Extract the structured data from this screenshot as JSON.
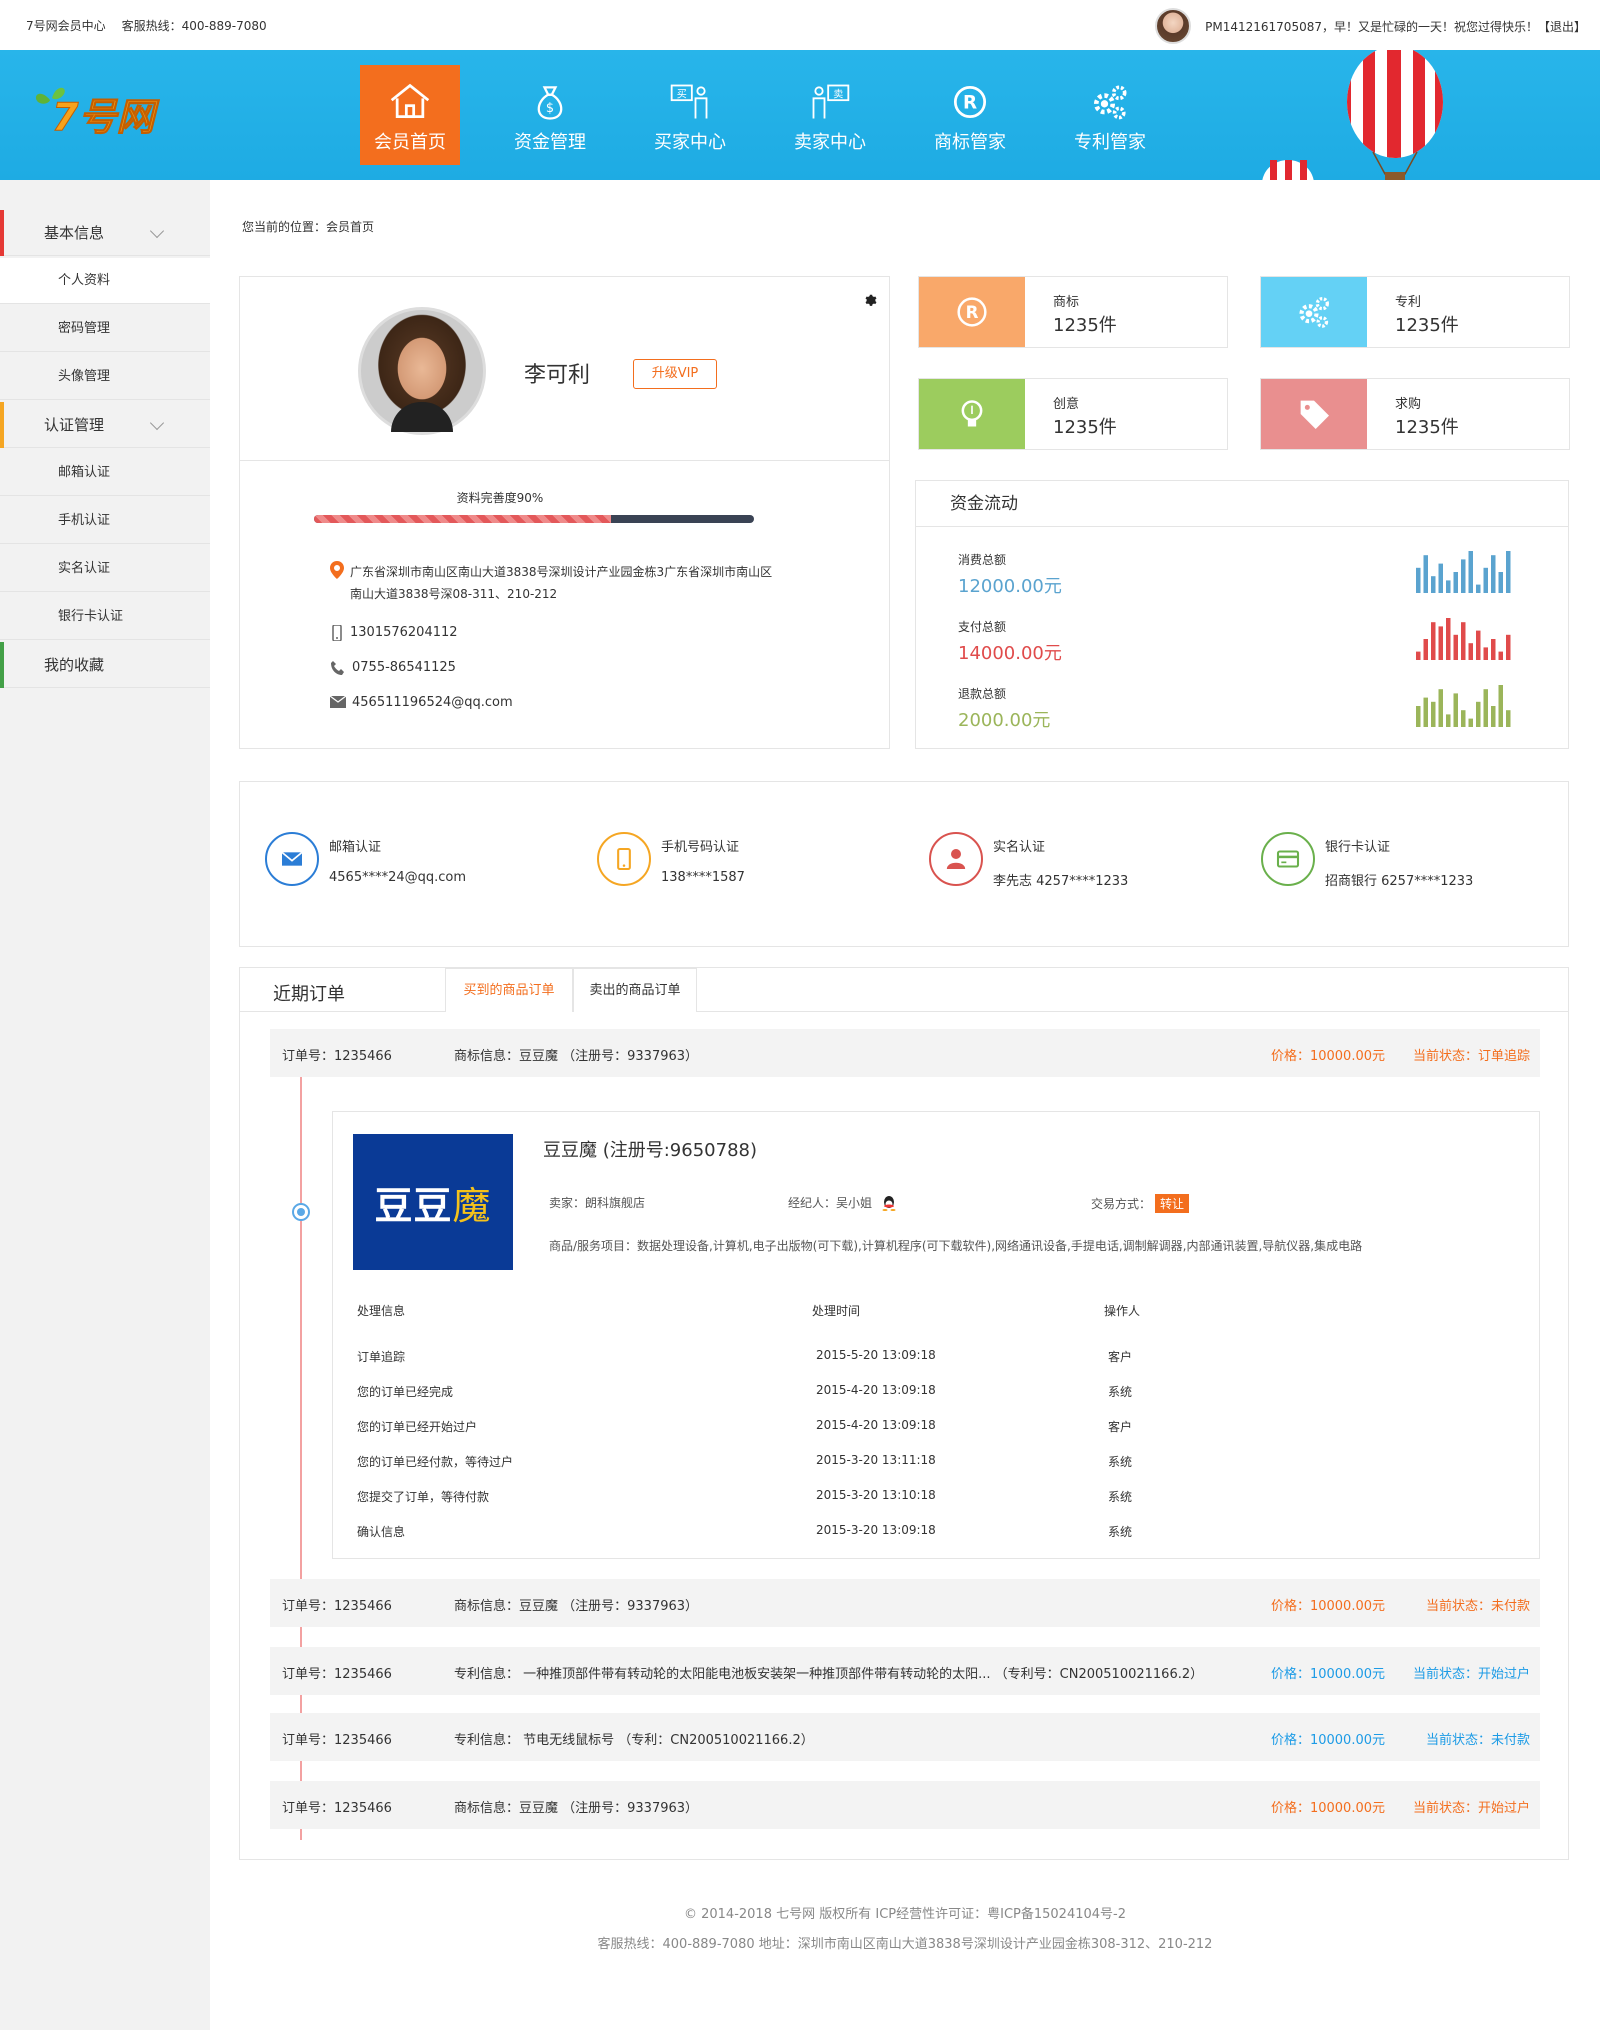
{
  "topbar": {
    "site": "7号网会员中心",
    "hotline": "客服热线：400-889-7080",
    "greeting": "PM1412161705087，早！又是忙碌的一天！祝您过得快乐！",
    "logout": "【退出】"
  },
  "header": {
    "logo_text": "7号网",
    "nav": [
      {
        "label": "会员首页",
        "icon": "home-icon",
        "active": true
      },
      {
        "label": "资金管理",
        "icon": "money-bag-icon"
      },
      {
        "label": "买家中心",
        "icon": "buyer-icon"
      },
      {
        "label": "卖家中心",
        "icon": "seller-icon"
      },
      {
        "label": "商标管家",
        "icon": "registered-icon"
      },
      {
        "label": "专利管家",
        "icon": "gears-icon"
      }
    ]
  },
  "sidebar": {
    "groups": [
      {
        "label": "基本信息",
        "color": "#e53935",
        "items": [
          "个人资料",
          "密码管理",
          "头像管理"
        ]
      },
      {
        "label": "认证管理",
        "color": "#f5a623",
        "items": [
          "邮箱认证",
          "手机认证",
          "实名认证",
          "银行卡认证"
        ]
      },
      {
        "label": "我的收藏",
        "color": "#43a047",
        "items": []
      }
    ]
  },
  "breadcrumb": "您当前的位置：会员首页",
  "profile": {
    "name": "李可利",
    "vip_button": "升级VIP",
    "completeness": "资料完善度90%",
    "completeness_value": 0.9,
    "address_line1": "广东省深圳市南山区南山大道3838号深圳设计产业园金栋3广东省深圳市南山区",
    "address_line2": "南山大道3838号深08-311、210-212",
    "mobile": "13015762041​12",
    "phone": "0755-86541125",
    "email": "456511196524@qq.com"
  },
  "stats": [
    {
      "label": "商标",
      "value": "1235件",
      "color": "#f9a86a",
      "icon": "registered-icon"
    },
    {
      "label": "专利",
      "value": "1235件",
      "color": "#64d1f5",
      "icon": "gears-icon"
    },
    {
      "label": "创意",
      "value": "1235件",
      "color": "#9ccc5e",
      "icon": "bulb-icon"
    },
    {
      "label": "求购",
      "value": "1235件",
      "color": "#e98f8f",
      "icon": "tag-icon"
    }
  ],
  "fund": {
    "title": "资金流动",
    "rows": [
      {
        "label": "消费总额",
        "value": "12000.00元",
        "color": "#5aa3cf",
        "bars": [
          0.6,
          0.9,
          0.4,
          0.7,
          0.3,
          0.5,
          0.8,
          1.0,
          0.2,
          0.6,
          0.9,
          0.5,
          1.0
        ]
      },
      {
        "label": "支付总额",
        "value": "14000.00元",
        "color": "#e04b4b",
        "bars": [
          0.2,
          0.5,
          0.9,
          0.8,
          1.0,
          0.6,
          0.9,
          0.4,
          0.7,
          0.3,
          0.5,
          0.2,
          0.6
        ]
      },
      {
        "label": "退款总额",
        "value": "2000.00元",
        "color": "#9bb55a",
        "bars": [
          0.5,
          0.7,
          0.6,
          0.9,
          0.3,
          0.8,
          0.4,
          0.2,
          0.6,
          0.9,
          0.5,
          1.0,
          0.4
        ]
      }
    ]
  },
  "certs": [
    {
      "title": "邮箱认证",
      "value": "4565****24@qq.com",
      "color": "#2b7dd6",
      "icon": "mail-icon"
    },
    {
      "title": "手机号码认证",
      "value": "138****1587",
      "color": "#f5a623",
      "icon": "phone-icon"
    },
    {
      "title": "实名认证",
      "value": "李先志    4257****1233",
      "color": "#d9534f",
      "icon": "person-icon"
    },
    {
      "title": "银行卡认证",
      "value": "招商银行    6257****1233",
      "color": "#6ab04c",
      "icon": "card-icon"
    }
  ],
  "orders": {
    "title": "近期订单",
    "tabs": [
      "买到的商品订单",
      "卖出的商品订单"
    ],
    "list": [
      {
        "no": "订单号：1235466",
        "info": "商标信息：豆豆魔  （注册号：9337963）",
        "price": "价格：10000.00元",
        "status": "当前状态：订单追踪",
        "style": "orange"
      },
      {
        "no": "订单号：1235466",
        "info": "商标信息：豆豆魔  （注册号：9337963）",
        "price": "价格：10000.00元",
        "status": "当前状态：未付款",
        "style": "orange"
      },
      {
        "no": "订单号：1235466",
        "info": "专利信息：  一种推顶部件带有转动轮的太阳能电池板安装架一种推顶部件带有转动轮的太阳...  （专利号：CN200510021166.2）",
        "price": "价格：10000.00元",
        "status": "当前状态：开始过户",
        "style": "blue"
      },
      {
        "no": "订单号：1235466",
        "info": "专利信息：  节电无线鼠标号  （专利：CN200510021166.2）",
        "price": "价格：10000.00元",
        "status": "当前状态：未付款",
        "style": "blue"
      },
      {
        "no": "订单号：1235466",
        "info": "商标信息：豆豆魔  （注册号：9337963）",
        "price": "价格：10000.00元",
        "status": "当前状态：开始过户",
        "style": "orange"
      }
    ],
    "detail": {
      "logo_a": "豆豆",
      "logo_b": "魔",
      "title": "豆豆魔 (注册号:9650788)",
      "seller": "卖家：朗科旗舰店",
      "agent": "经纪人：吴小姐",
      "trade": "交易方式：",
      "trade_tag": "转让",
      "services": "商品/服务项目：数据处理设备,计算机,电子出版物(可下载),计算机程序(可下载软件),网络通讯设备,手提电话,调制解调器,内部通讯装置,导航仪器,集成电路",
      "log_headers": [
        "处理信息",
        "处理时间",
        "操作人"
      ],
      "logs": [
        [
          "订单追踪",
          "2015-5-20  13:09:18",
          "客户"
        ],
        [
          "您的订单已经完成",
          "2015-4-20  13:09:18",
          "系统"
        ],
        [
          "您的订单已经开始过户",
          "2015-4-20  13:09:18",
          "客户"
        ],
        [
          "您的订单已经付款，等待过户",
          "2015-3-20  13:11:18",
          "系统"
        ],
        [
          "您提交了订单，等待付款",
          "2015-3-20  13:10:18",
          "系统"
        ],
        [
          "确认信息",
          "2015-3-20  13:09:18",
          "系统"
        ]
      ]
    }
  },
  "footer": {
    "line1": "© 2014-2018 七号网 版权所有 ICP经营性许可证：粤ICP备15024104号-2",
    "line2": "客服热线：400-889-7080  地址：深圳市南山区南山大道3838号深圳设计产业园金栋308-312、210-212"
  }
}
